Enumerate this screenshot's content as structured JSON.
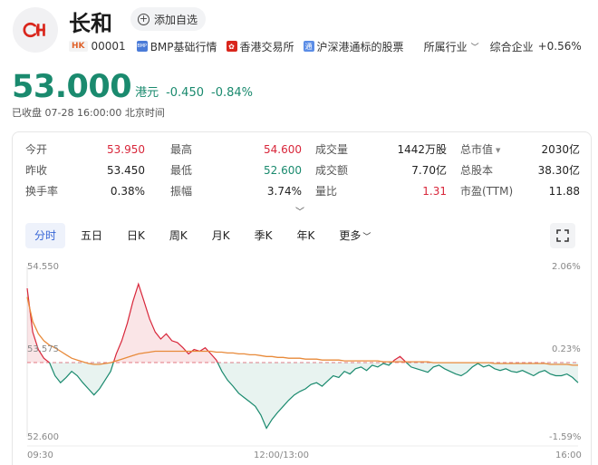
{
  "header": {
    "stock_name": "长和",
    "watch_label": "添加自选",
    "market_badge": "HK",
    "code": "00001",
    "links": [
      {
        "label": "BMP基础行情",
        "icon": "bmp-icon"
      },
      {
        "label": "香港交易所",
        "icon": "hkex-icon"
      },
      {
        "label": "沪深港通标的股票",
        "icon": "connect-icon"
      }
    ],
    "industry_label": "所属行业",
    "sector_name": "综合企业",
    "sector_change": "+0.56%",
    "logo_icon": "ck-hutchison-logo"
  },
  "quote": {
    "price": "53.000",
    "currency": "港元",
    "change": "-0.450",
    "change_pct": "-0.84%",
    "status": "已收盘  07-28 16:00:00 北京时间"
  },
  "stats": [
    [
      {
        "label": "今开",
        "value": "53.950",
        "color": "red"
      },
      {
        "label": "最高",
        "value": "54.600",
        "color": "red"
      },
      {
        "label": "成交量",
        "value": "1442万股",
        "color": "plain"
      },
      {
        "label": "总市值",
        "value": "2030亿",
        "color": "plain",
        "caret": true
      }
    ],
    [
      {
        "label": "昨收",
        "value": "53.450",
        "color": "plain"
      },
      {
        "label": "最低",
        "value": "52.600",
        "color": "green"
      },
      {
        "label": "成交额",
        "value": "7.70亿",
        "color": "plain"
      },
      {
        "label": "总股本",
        "value": "38.30亿",
        "color": "plain"
      }
    ],
    [
      {
        "label": "换手率",
        "value": "0.38%",
        "color": "plain"
      },
      {
        "label": "振幅",
        "value": "3.74%",
        "color": "plain"
      },
      {
        "label": "量比",
        "value": "1.31",
        "color": "red"
      },
      {
        "label": "市盈(TTM)",
        "value": "11.88",
        "color": "plain"
      }
    ]
  ],
  "tabs": [
    "分时",
    "五日",
    "日K",
    "周K",
    "月K",
    "季K",
    "年K",
    "更多"
  ],
  "active_tab": "分时",
  "colors": {
    "down": "#1a8a6e",
    "up": "#d8263a",
    "avg_line": "#e88a3a",
    "accent": "#3766d6"
  },
  "chart_data": {
    "type": "line",
    "y_left_ticks": [
      "54.550",
      "53.575",
      "52.600"
    ],
    "y_right_ticks": [
      "2.06%",
      "0.23%",
      "-1.59%"
    ],
    "x_ticks": [
      "09:30",
      "12:00/13:00",
      "16:00"
    ],
    "ylim": [
      52.6,
      54.55
    ],
    "prev_close": 53.45,
    "price_series": [
      54.3,
      53.8,
      53.6,
      53.5,
      53.45,
      53.3,
      53.22,
      53.28,
      53.35,
      53.3,
      53.22,
      53.15,
      53.08,
      53.15,
      53.25,
      53.35,
      53.55,
      53.7,
      53.9,
      54.15,
      54.35,
      54.15,
      53.95,
      53.8,
      53.72,
      53.78,
      53.7,
      53.68,
      53.62,
      53.55,
      53.6,
      53.58,
      53.62,
      53.55,
      53.48,
      53.35,
      53.25,
      53.18,
      53.1,
      53.05,
      53.0,
      52.95,
      52.85,
      52.7,
      52.8,
      52.88,
      52.95,
      53.02,
      53.08,
      53.12,
      53.15,
      53.2,
      53.22,
      53.18,
      53.24,
      53.3,
      53.28,
      53.35,
      53.32,
      53.38,
      53.4,
      53.36,
      53.42,
      53.4,
      53.44,
      53.42,
      53.48,
      53.52,
      53.46,
      53.4,
      53.38,
      53.36,
      53.34,
      53.4,
      53.42,
      53.38,
      53.35,
      53.32,
      53.3,
      53.34,
      53.4,
      53.44,
      53.4,
      53.42,
      53.38,
      53.36,
      53.38,
      53.35,
      53.34,
      53.36,
      53.33,
      53.3,
      53.34,
      53.36,
      53.32,
      53.3,
      53.3,
      53.32,
      53.28,
      53.22
    ],
    "avg_series": [
      54.2,
      53.92,
      53.78,
      53.7,
      53.65,
      53.62,
      53.58,
      53.54,
      53.5,
      53.48,
      53.46,
      53.44,
      53.43,
      53.43,
      53.44,
      53.45,
      53.47,
      53.49,
      53.51,
      53.53,
      53.55,
      53.56,
      53.57,
      53.58,
      53.58,
      53.58,
      53.58,
      53.58,
      53.58,
      53.58,
      53.58,
      53.58,
      53.58,
      53.58,
      53.57,
      53.57,
      53.56,
      53.56,
      53.55,
      53.55,
      53.54,
      53.54,
      53.53,
      53.52,
      53.52,
      53.51,
      53.51,
      53.5,
      53.5,
      53.5,
      53.49,
      53.49,
      53.49,
      53.48,
      53.48,
      53.48,
      53.48,
      53.47,
      53.47,
      53.47,
      53.47,
      53.47,
      53.47,
      53.47,
      53.46,
      53.46,
      53.46,
      53.46,
      53.46,
      53.46,
      53.46,
      53.46,
      53.46,
      53.45,
      53.45,
      53.45,
      53.45,
      53.45,
      53.45,
      53.45,
      53.45,
      53.45,
      53.45,
      53.45,
      53.44,
      53.44,
      53.44,
      53.44,
      53.44,
      53.44,
      53.44,
      53.44,
      53.44,
      53.44,
      53.43,
      53.43,
      53.43,
      53.43,
      53.42,
      53.42
    ]
  }
}
